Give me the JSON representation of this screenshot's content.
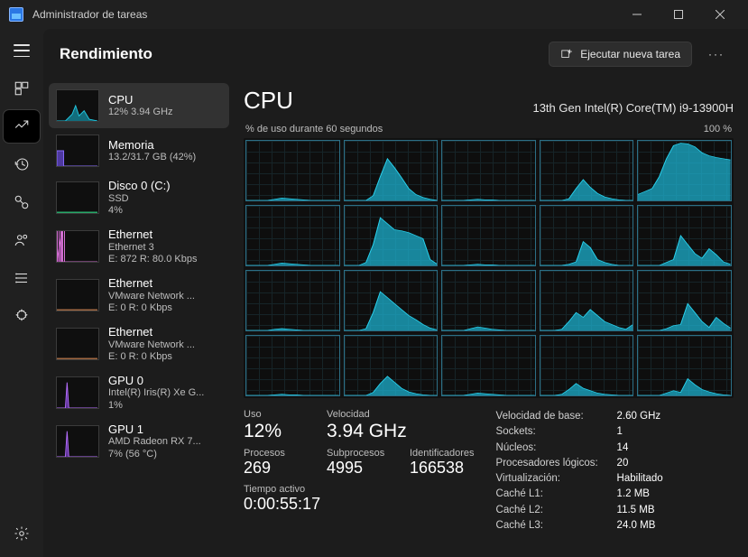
{
  "window": {
    "title": "Administrador de tareas"
  },
  "header": {
    "page_title": "Rendimiento",
    "run_task_label": "Ejecutar nueva tarea",
    "more_label": "···"
  },
  "rail": {
    "items": [
      {
        "name": "menu"
      },
      {
        "name": "processes"
      },
      {
        "name": "performance",
        "active": true
      },
      {
        "name": "history"
      },
      {
        "name": "startup"
      },
      {
        "name": "users"
      },
      {
        "name": "details"
      },
      {
        "name": "services"
      }
    ]
  },
  "sidebar": {
    "items": [
      {
        "title": "CPU",
        "sub": "12% 3.94 GHz",
        "type": "cpu",
        "selected": true
      },
      {
        "title": "Memoria",
        "sub": "13.2/31.7 GB (42%)",
        "type": "mem"
      },
      {
        "title": "Disco 0 (C:)",
        "sub": "SSD",
        "sub2": "4%",
        "type": "disk"
      },
      {
        "title": "Ethernet",
        "sub": "Ethernet 3",
        "sub2": "E: 872 R: 80.0 Kbps",
        "type": "eth_main"
      },
      {
        "title": "Ethernet",
        "sub": "VMware Network ...",
        "sub2": "E: 0 R: 0 Kbps",
        "type": "eth"
      },
      {
        "title": "Ethernet",
        "sub": "VMware Network ...",
        "sub2": "E: 0 R: 0 Kbps",
        "type": "eth"
      },
      {
        "title": "GPU 0",
        "sub": "Intel(R) Iris(R) Xe G...",
        "sub2": "1%",
        "type": "gpu"
      },
      {
        "title": "GPU 1",
        "sub": "AMD Radeon RX 7...",
        "sub2": "7% (56 °C)",
        "type": "gpu"
      }
    ]
  },
  "main": {
    "title": "CPU",
    "subtitle": "13th Gen Intel(R) Core(TM) i9-13900H",
    "graph_caption_left": "% de uso durante 60 segundos",
    "graph_caption_right": "100 %"
  },
  "stats": {
    "usage_label": "Uso",
    "usage_value": "12%",
    "speed_label": "Velocidad",
    "speed_value": "3.94 GHz",
    "processes_label": "Procesos",
    "processes_value": "269",
    "threads_label": "Subprocesos",
    "threads_value": "4995",
    "handles_label": "Identificadores",
    "handles_value": "166538",
    "uptime_label": "Tiempo activo",
    "uptime_value": "0:00:55:17"
  },
  "details": {
    "base_speed_k": "Velocidad de base:",
    "base_speed_v": "2.60 GHz",
    "sockets_k": "Sockets:",
    "sockets_v": "1",
    "cores_k": "Núcleos:",
    "cores_v": "14",
    "logical_k": "Procesadores lógicos:",
    "logical_v": "20",
    "virt_k": "Virtualización:",
    "virt_v": "Habilitado",
    "l1_k": "Caché L1:",
    "l1_v": "1.2 MB",
    "l2_k": "Caché L2:",
    "l2_v": "11.5 MB",
    "l3_k": "Caché L3:",
    "l3_v": "24.0 MB"
  },
  "chart_data": {
    "type": "area",
    "title": "% de uso durante 60 segundos",
    "xlabel": "segundos",
    "ylabel": "% uso",
    "ylim": [
      0,
      100
    ],
    "x_seconds": 60,
    "grid_rows": 4,
    "grid_cols": 5,
    "note": "20 per-logical-processor usage sparklines, values estimated from pixels",
    "series": [
      {
        "name": "LP0",
        "values": [
          0,
          0,
          0,
          0,
          2,
          4,
          3,
          2,
          1,
          0,
          0,
          0,
          0,
          0
        ]
      },
      {
        "name": "LP1",
        "values": [
          0,
          0,
          0,
          0,
          8,
          40,
          70,
          55,
          38,
          20,
          10,
          5,
          2,
          0
        ]
      },
      {
        "name": "LP2",
        "values": [
          0,
          0,
          0,
          0,
          1,
          2,
          1,
          1,
          0,
          0,
          0,
          0,
          0,
          0
        ]
      },
      {
        "name": "LP3",
        "values": [
          0,
          0,
          0,
          0,
          3,
          20,
          35,
          22,
          12,
          6,
          3,
          1,
          0,
          0
        ]
      },
      {
        "name": "LP4",
        "values": [
          10,
          15,
          20,
          40,
          70,
          92,
          96,
          95,
          90,
          80,
          75,
          72,
          70,
          68
        ]
      },
      {
        "name": "LP5",
        "values": [
          0,
          0,
          0,
          0,
          2,
          4,
          3,
          2,
          1,
          0,
          0,
          0,
          0,
          0
        ]
      },
      {
        "name": "LP6",
        "values": [
          0,
          0,
          0,
          5,
          35,
          80,
          70,
          60,
          58,
          55,
          50,
          45,
          10,
          2
        ]
      },
      {
        "name": "LP7",
        "values": [
          0,
          0,
          0,
          0,
          1,
          2,
          1,
          1,
          0,
          0,
          0,
          0,
          0,
          0
        ]
      },
      {
        "name": "LP8",
        "values": [
          0,
          0,
          0,
          0,
          2,
          6,
          40,
          30,
          10,
          5,
          2,
          0,
          0,
          0
        ]
      },
      {
        "name": "LP9",
        "values": [
          0,
          0,
          0,
          0,
          5,
          10,
          50,
          35,
          20,
          12,
          28,
          18,
          6,
          2
        ]
      },
      {
        "name": "LP10",
        "values": [
          0,
          0,
          0,
          0,
          2,
          3,
          2,
          1,
          0,
          0,
          0,
          0,
          0,
          0
        ]
      },
      {
        "name": "LP11",
        "values": [
          0,
          0,
          0,
          3,
          30,
          65,
          55,
          45,
          35,
          25,
          18,
          10,
          4,
          1
        ]
      },
      {
        "name": "LP12",
        "values": [
          0,
          0,
          0,
          0,
          3,
          6,
          4,
          2,
          1,
          0,
          0,
          0,
          0,
          0
        ]
      },
      {
        "name": "LP13",
        "values": [
          0,
          0,
          0,
          2,
          15,
          30,
          22,
          35,
          25,
          15,
          10,
          5,
          2,
          10
        ]
      },
      {
        "name": "LP14",
        "values": [
          0,
          0,
          0,
          0,
          3,
          8,
          10,
          45,
          30,
          15,
          5,
          22,
          12,
          4
        ]
      },
      {
        "name": "LP15",
        "values": [
          0,
          0,
          0,
          0,
          1,
          2,
          1,
          1,
          0,
          0,
          0,
          0,
          0,
          0
        ]
      },
      {
        "name": "LP16",
        "values": [
          0,
          0,
          0,
          0,
          5,
          20,
          32,
          22,
          12,
          6,
          3,
          1,
          0,
          0
        ]
      },
      {
        "name": "LP17",
        "values": [
          0,
          0,
          0,
          0,
          2,
          4,
          3,
          2,
          1,
          0,
          0,
          0,
          0,
          0
        ]
      },
      {
        "name": "LP18",
        "values": [
          0,
          0,
          0,
          2,
          10,
          20,
          12,
          8,
          4,
          2,
          1,
          0,
          0,
          0
        ]
      },
      {
        "name": "LP19",
        "values": [
          0,
          0,
          0,
          0,
          4,
          8,
          5,
          28,
          18,
          10,
          6,
          3,
          1,
          0
        ]
      }
    ]
  }
}
